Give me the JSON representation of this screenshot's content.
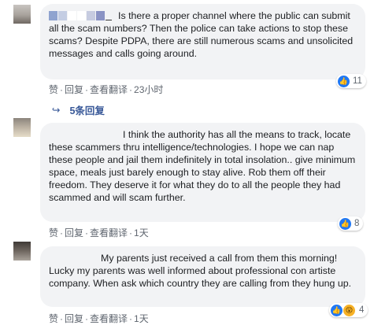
{
  "colors": {
    "bubble": "#f2f3f5",
    "link": "#385898",
    "muted": "#606770",
    "like": "#2078f4",
    "wow": "#f7b125"
  },
  "comments": [
    {
      "text": "Is there a proper channel where the public can submit all the scam numbers? Then the police can take actions to stop these scams? Despite PDPA, there are still numerous scams and unsolicited messages and calls going around.",
      "actions": {
        "like": "赞",
        "reply": "回复",
        "translate": "查看翻译",
        "time": "23小时"
      },
      "reaction_count": "11",
      "reaction_icons": [
        "like-icon"
      ]
    },
    {
      "text": "I think the authority has all the means to track, locate these scammers thru intelligence/technologies. I hope we can nap these people and jail them indefinitely in total insolation.. give minimum space, meals just barely enough to stay alive. Rob them off their freedom. They deserve it for what they do to all the people they had scammed and will scam further.",
      "actions": {
        "like": "赞",
        "reply": "回复",
        "translate": "查看翻译",
        "time": "1天"
      },
      "reaction_count": "8",
      "reaction_icons": [
        "like-icon"
      ]
    },
    {
      "text": "My parents just received a call from them this morning! Lucky my parents was well informed about professional con artiste company. When ask which country they are calling from they hung up.",
      "actions": {
        "like": "赞",
        "reply": "回复",
        "translate": "查看翻译",
        "time": "1天"
      },
      "reaction_count": "4",
      "reaction_icons": [
        "like-icon",
        "wow-icon"
      ]
    }
  ],
  "replies_link": {
    "label": "5条回复"
  }
}
